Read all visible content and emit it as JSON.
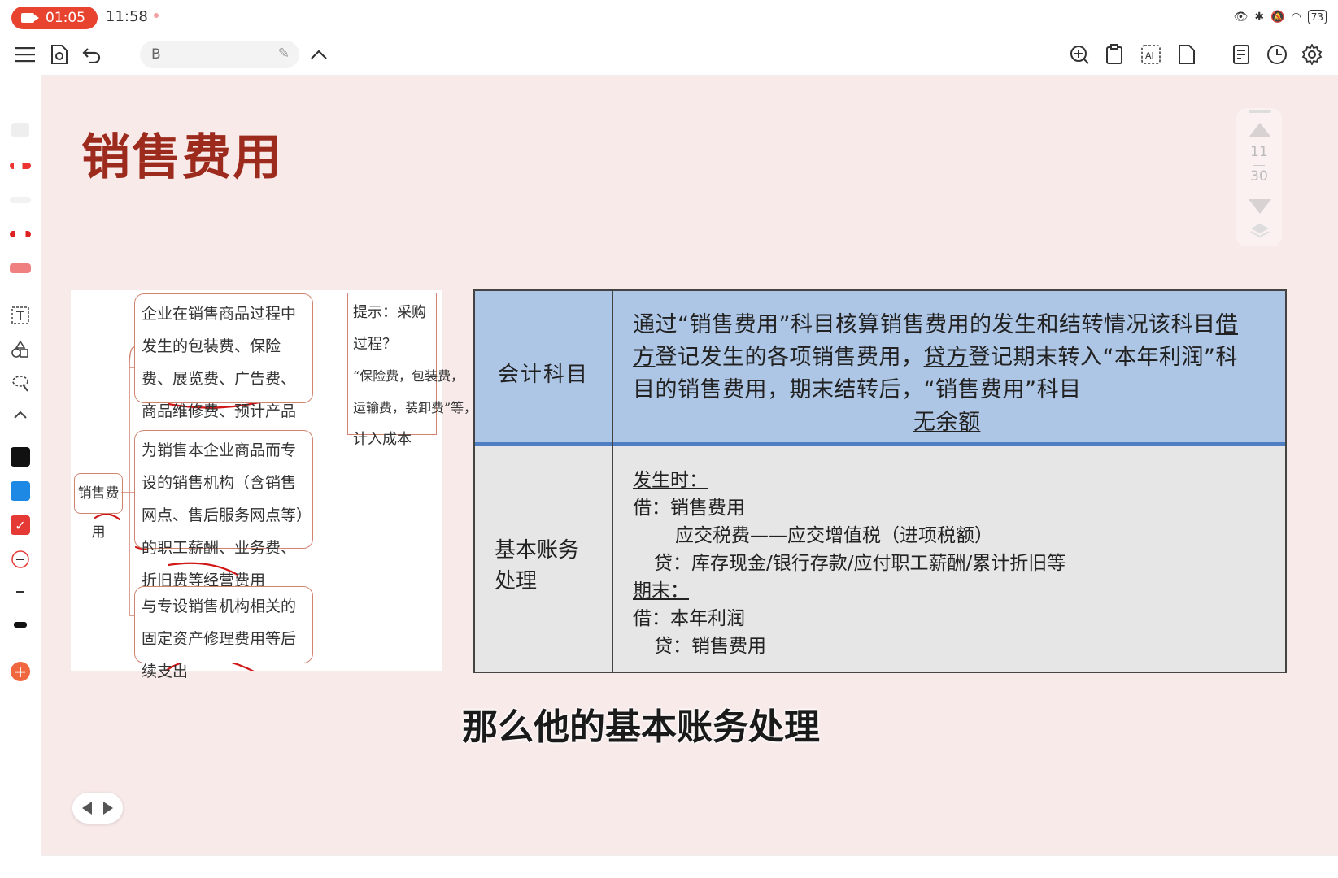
{
  "status_bar": {
    "recording_time": "01:05",
    "clock": "11:58",
    "battery": "73"
  },
  "toolbar": {
    "search_value": "B"
  },
  "slide": {
    "title": "销售费用",
    "page_current": "11",
    "page_total": "30",
    "subtitle": "那么他的基本账务处理"
  },
  "mindmap": {
    "root": "销售费用",
    "nodes": [
      "企业在销售商品过程中发生的包装费、保险费、展览费、广告费、商品维修费、预计产品质量保证损失、运输费、装卸费等",
      "为销售本企业商品而专设的销售机构（含销售网点、售后服务网点等）的职工薪酬、业务费、折旧费等经营费用",
      "与专设销售机构相关的固定资产修理费用等后续支出"
    ],
    "tip": [
      "提示：采购过程？",
      "“保险费，包装费，",
      "运输费，装卸费”等，",
      "计入成本"
    ]
  },
  "table": {
    "row1_label": "会计科目",
    "row1_p1": "通过“销售费用”科目核算销售费用的发生和结转情况该科目",
    "row1_u1": "借方",
    "row1_p2": "登记发生的各项销售费用，",
    "row1_u2": "贷方",
    "row1_p3": "登记期末转入“本年利润”科目的销售费用，期末结转后，“销售费用”科目",
    "row1_u3": "无余额",
    "row2_label": "基本账务处理",
    "row2_lines": [
      "发生时：",
      "借：销售费用",
      "应交税费——应交增值税（进项税额）",
      "贷：库存现金/银行存款/应付职工薪酬/累计折旧等",
      "期末：",
      "借：本年利润",
      "贷：销售费用"
    ]
  },
  "colors": {
    "title": "#9c2a1d",
    "slide_bg": "#f9eaea",
    "table_header_bg": "#aec6e6",
    "table_body_bg": "#e6e6e6",
    "accent_red": "#e8432f"
  }
}
